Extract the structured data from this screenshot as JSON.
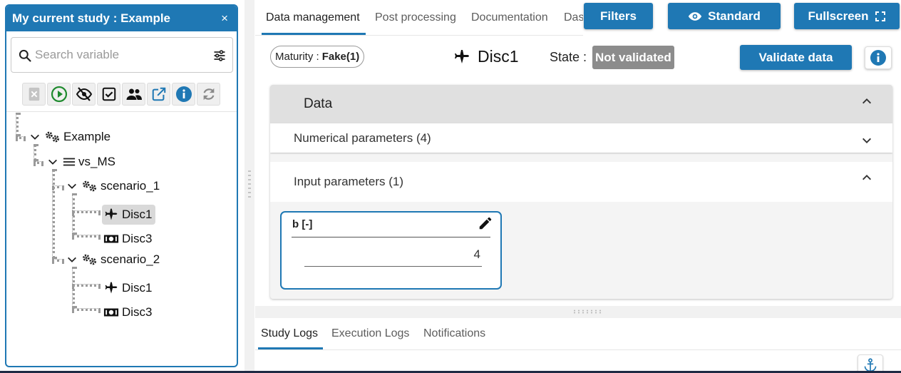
{
  "study_panel": {
    "title": "My current study : Example",
    "close_icon": "×",
    "search_placeholder": "Search variable"
  },
  "tree": [
    {
      "label": "Example",
      "icon": "gears-icon",
      "depth": 0,
      "expanded": true
    },
    {
      "label": "vs_MS",
      "icon": "list-icon",
      "depth": 1,
      "expanded": true
    },
    {
      "label": "scenario_1",
      "icon": "gears-icon",
      "depth": 2,
      "expanded": true
    },
    {
      "label": "Disc1",
      "icon": "airplane-icon",
      "depth": 3,
      "selected": true
    },
    {
      "label": "Disc3",
      "icon": "banknote-icon",
      "depth": 3
    },
    {
      "label": "scenario_2",
      "icon": "gears-icon",
      "depth": 2,
      "expanded": true
    },
    {
      "label": "Disc1",
      "icon": "airplane-icon",
      "depth": 3
    },
    {
      "label": "Disc3",
      "icon": "banknote-icon",
      "depth": 3
    }
  ],
  "tabs": [
    "Data management",
    "Post processing",
    "Documentation",
    "Das"
  ],
  "top_buttons": {
    "filters": "Filters",
    "standard": "Standard",
    "fullscreen": "Fullscreen"
  },
  "discipline": {
    "maturity_label": "Maturity :",
    "maturity_value": "Fake(1)",
    "name": "Disc1",
    "state_label": "State :",
    "state_value": "Not validated",
    "validate_button": "Validate data"
  },
  "data_section": {
    "title": "Data",
    "numerical_params": "Numerical parameters (4)",
    "input_params": "Input parameters (1)",
    "param": {
      "name": "b [-]",
      "value": "4"
    }
  },
  "log_tabs": [
    "Study Logs",
    "Execution Logs",
    "Notifications"
  ],
  "colors": {
    "primary": "#1f78b4",
    "state_badge": "#8c8c8c"
  }
}
